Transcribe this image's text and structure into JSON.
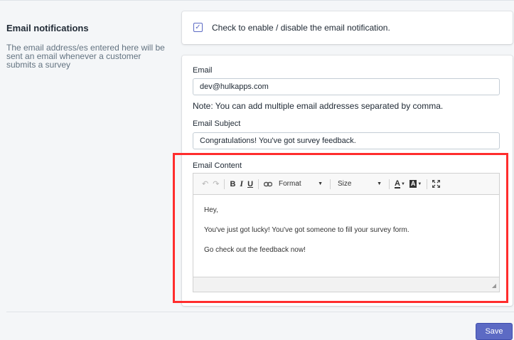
{
  "section": {
    "title": "Email notifications",
    "description": "The email address/es entered here will be sent an email whenever a customer submits a survey"
  },
  "enable": {
    "checked": true,
    "label": "Check to enable / disable the email notification."
  },
  "email": {
    "label": "Email",
    "value": "dev@hulkapps.com",
    "note": "Note: You can add multiple email addresses separated by comma."
  },
  "subject": {
    "label": "Email Subject",
    "value": "Congratulations! You've got survey feedback."
  },
  "content": {
    "label": "Email Content",
    "toolbar": {
      "undo_icon": "undo-icon",
      "redo_icon": "redo-icon",
      "bold": "B",
      "italic": "I",
      "underline": "U",
      "link_icon": "link-icon",
      "format": "Format",
      "size": "Size",
      "text_color": "A",
      "bg_color": "A",
      "maximize_icon": "maximize-icon"
    },
    "paragraphs": [
      "Hey,",
      "You've just got lucky! You've got someone to fill your survey form.",
      "Go check out the feedback now!"
    ]
  },
  "save_label": "Save",
  "colors": {
    "accent": "#5c6ac4",
    "highlight": "#ff2d2d"
  }
}
